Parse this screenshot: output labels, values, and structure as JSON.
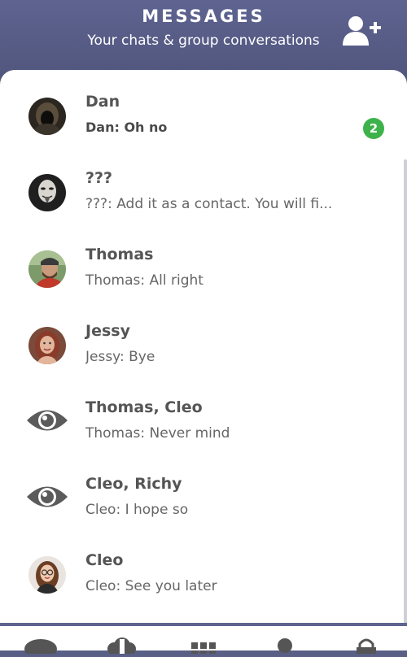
{
  "header": {
    "title": "MESSAGES",
    "subtitle": "Your chats & group conversations",
    "add_icon": "add-user-icon"
  },
  "chats": [
    {
      "name": "Dan",
      "preview": "Dan: Oh no",
      "unread": "2",
      "avatar": "hooded-figure-avatar"
    },
    {
      "name": "???",
      "preview": "???: Add it as a contact. You will fi...",
      "avatar": "mask-avatar"
    },
    {
      "name": "Thomas",
      "preview": "Thomas: All right",
      "avatar": "bearded-man-avatar"
    },
    {
      "name": "Jessy",
      "preview": "Jessy: Bye",
      "avatar": "woman-avatar"
    },
    {
      "name": "Thomas, Cleo",
      "preview": "Thomas: Never mind",
      "avatar": "eye-icon"
    },
    {
      "name": "Cleo, Richy",
      "preview": "Cleo: I hope so",
      "avatar": "eye-icon"
    },
    {
      "name": "Cleo",
      "preview": "Cleo: See you later",
      "avatar": "woman-glasses-avatar"
    }
  ],
  "colors": {
    "header": "#5e6390",
    "badge": "#3db24a",
    "text_dark": "#555555",
    "text_light": "#666666"
  },
  "navbar": {
    "icons": [
      "chat-icon",
      "cloud-upload-icon",
      "apps-grid-icon",
      "profile-icon",
      "lock-icon"
    ]
  }
}
